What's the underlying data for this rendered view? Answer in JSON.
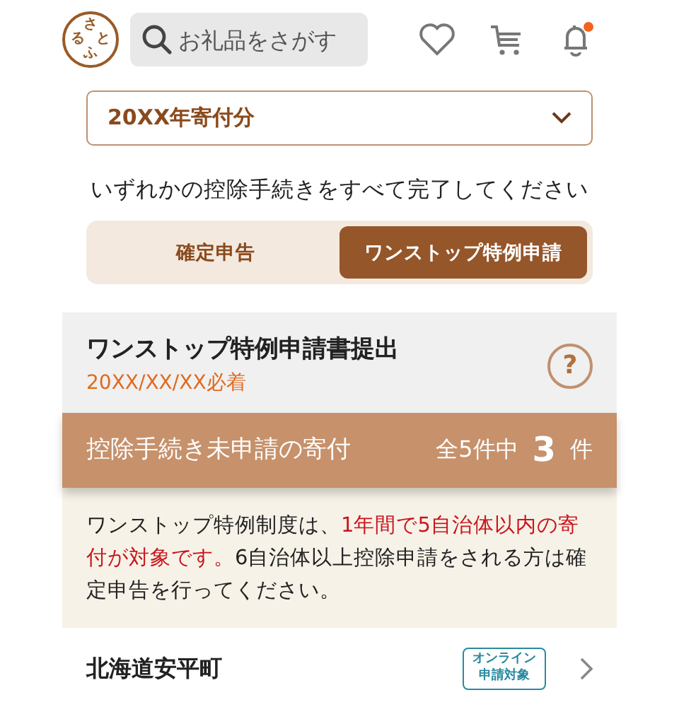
{
  "header": {
    "logo_chars": [
      "さ",
      "る",
      "と",
      "ふ"
    ],
    "search": {
      "placeholder": "お礼品をさがす"
    },
    "notification_unread": true
  },
  "year_select": {
    "value": "20XX年寄付分"
  },
  "instruction": "いずれかの控除手続きをすべて完了してください",
  "tabs": [
    {
      "label": "確定申告",
      "selected": false
    },
    {
      "label": "ワンストップ特例申請",
      "selected": true
    }
  ],
  "submission": {
    "title": "ワンストップ特例申請書提出",
    "deadline": "20XX/XX/XX必着",
    "help": "?"
  },
  "pending_bar": {
    "title": "控除手続き未申請の寄付",
    "total_prefix": "全5件中",
    "count": "3",
    "unit": "件"
  },
  "notice": [
    {
      "text": "ワンストップ特例制度は、",
      "emphasis": false
    },
    {
      "text": "1年間で5自治体以内の寄付が対象です。",
      "emphasis": true
    },
    {
      "text": "6自治体以上控除申請をされる方は確定申告を行ってください。",
      "emphasis": false
    }
  ],
  "donations": [
    {
      "municipality": "北海道安平町",
      "tag_lines": [
        "オンライン",
        "申請対象"
      ]
    }
  ]
}
